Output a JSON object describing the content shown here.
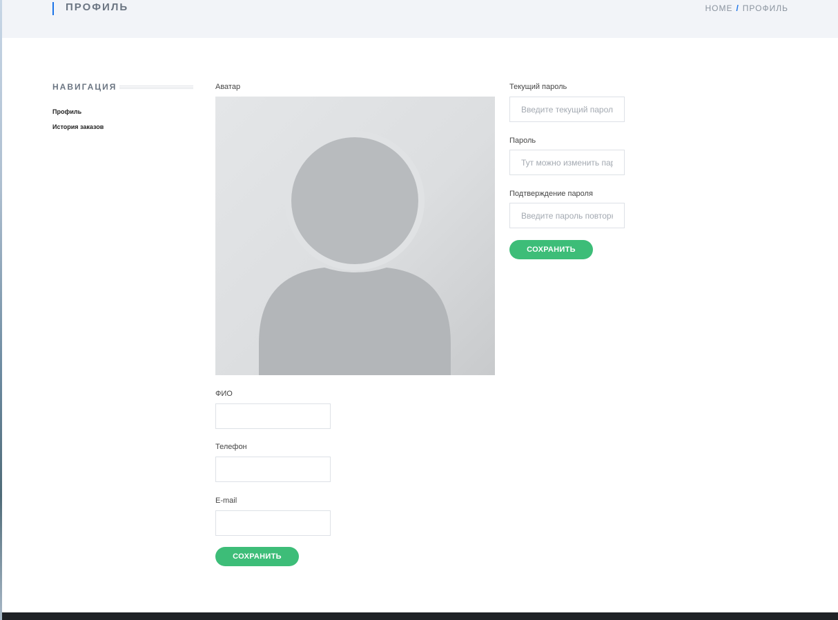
{
  "header": {
    "title": "ПРОФИЛЬ",
    "breadcrumb": {
      "home": "HOME",
      "separator": "/",
      "current": "ПРОФИЛЬ"
    }
  },
  "sidebar": {
    "heading": "НАВИГАЦИЯ",
    "items": [
      {
        "label": "Профиль"
      },
      {
        "label": "История заказов"
      }
    ]
  },
  "profile_form": {
    "avatar_label": "Аватар",
    "avatar_icon": "user-silhouette-icon",
    "fio_label": "ФИО",
    "fio_value": "",
    "phone_label": "Телефон",
    "phone_value": "",
    "email_label": "E-mail",
    "email_value": "",
    "save_label": "СОХРАНИТЬ"
  },
  "password_form": {
    "current_label": "Текущий пароль",
    "current_placeholder": "Введите текущий пароль",
    "new_label": "Пароль",
    "new_placeholder": "Тут можно изменить пароль",
    "confirm_label": "Подтверждение пароля",
    "confirm_placeholder": "Введите пароль повторно",
    "save_label": "СОХРАНИТЬ"
  },
  "colors": {
    "accent": "#1a73e8",
    "button": "#3dbd78",
    "header_bg": "#f2f4f8",
    "footer_bg": "#1f2226"
  }
}
